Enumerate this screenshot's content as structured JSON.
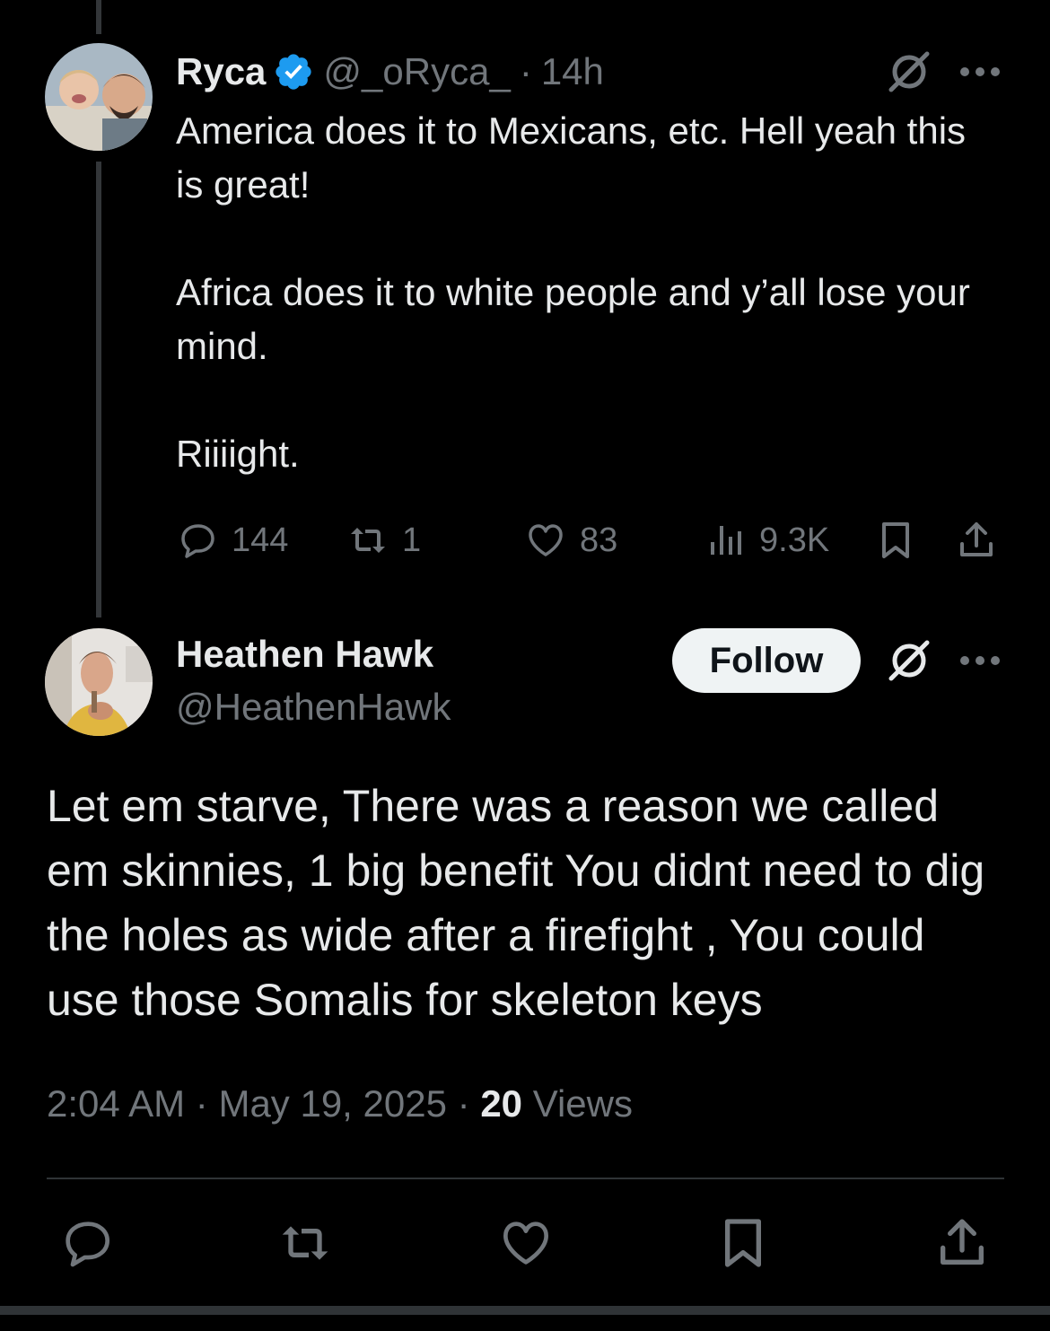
{
  "colors": {
    "background": "#000000",
    "text": "#e7e9ea",
    "muted": "#71767b",
    "verified": "#1d9bf0",
    "follow_bg": "#eff3f4"
  },
  "reply": {
    "name": "Ryca",
    "verified_icon": "verified-badge-icon",
    "handle": "@_oRyca_",
    "separator": "·",
    "time": "14h",
    "paragraphs": [
      "America does it to Mexicans, etc. Hell yeah this is great!",
      "",
      "Africa does it to white people and y’all lose your mind.",
      "",
      "Riiiight."
    ],
    "metrics": {
      "replies": "144",
      "reposts": "1",
      "likes": "83",
      "views": "9.3K"
    }
  },
  "main": {
    "name": "Heathen Hawk",
    "handle": "@HeathenHawk",
    "follow_label": "Follow",
    "body": "Let em starve, There was a reason we called em skinnies, 1 big benefit You didnt need to dig the holes as wide after a firefight , You could use those  Somalis for skeleton keys",
    "time": "2:04 AM",
    "sep1": "·",
    "date": "May 19, 2025",
    "sep2": "·",
    "views_count": "20",
    "views_label": "Views"
  }
}
